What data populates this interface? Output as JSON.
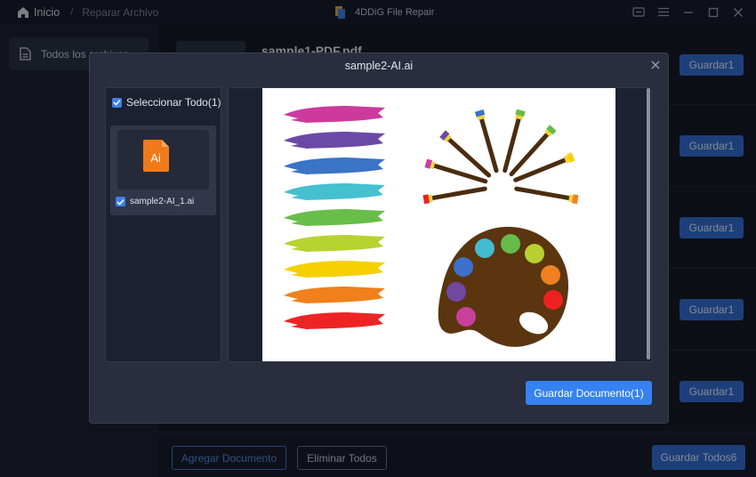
{
  "titlebar": {
    "home_label": "Inicio",
    "separator": "/",
    "page_label": "Reparar Archivo",
    "app_title": "4DDiG File Repair"
  },
  "sidebar": {
    "items": [
      {
        "label": "Todos los archivos",
        "icon": "document-icon"
      }
    ]
  },
  "files": [
    {
      "name": "sample1-PDF.pdf",
      "save_label": "Guardar1"
    },
    {
      "name": "",
      "save_label": "Guardar1"
    },
    {
      "name": "",
      "save_label": "Guardar1"
    },
    {
      "name": "",
      "save_label": "Guardar1"
    },
    {
      "name": "",
      "save_label": "Guardar1"
    }
  ],
  "footer": {
    "add_label": "Agregar Documento",
    "remove_all_label": "Eliminar Todos",
    "save_all_label": "Guardar Todos6"
  },
  "modal": {
    "title": "sample2-AI.ai",
    "select_all_label": "Seleccionar Todo(1)",
    "select_all_checked": true,
    "file": {
      "name": "sample2-AI_1.ai",
      "checked": true,
      "icon_text": "Ai"
    },
    "save_label": "Guardar Documento(1)"
  },
  "colors": {
    "accent": "#3582f0",
    "button_blue": "#2e6bd0",
    "ai_icon": "#f07a1a"
  }
}
